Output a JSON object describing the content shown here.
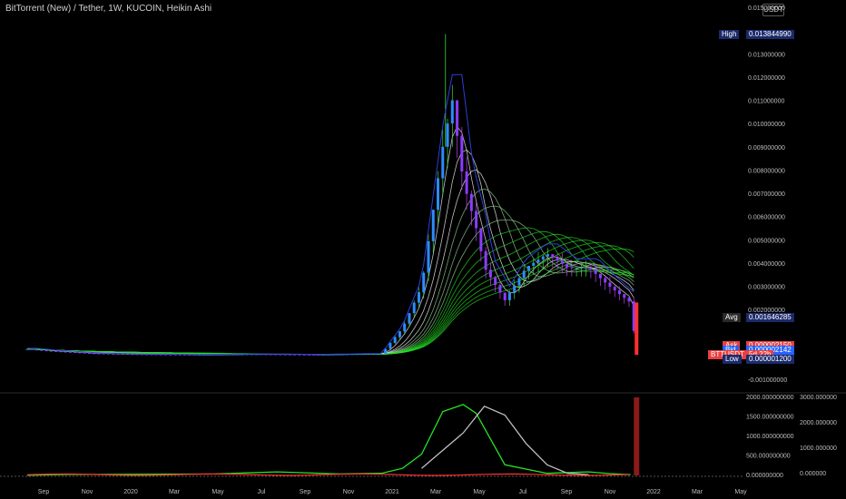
{
  "header": {
    "title": "BitTorrent (New) / Tether, 1W, KUCOIN, Heikin Ashi",
    "currency": "USDT"
  },
  "price_axis": {
    "ticks": [
      "0.015000000",
      "0.014000000",
      "0.013000000",
      "0.012000000",
      "0.011000000",
      "0.010000000",
      "0.009000000",
      "0.008000000",
      "0.007000000",
      "0.006000000",
      "0.005000000",
      "0.004000000",
      "0.003000000",
      "0.002000000",
      "0.001000000",
      "0.000000000",
      "-0.001000000"
    ],
    "tick_values": [
      0.015,
      0.014,
      0.013,
      0.012,
      0.011,
      0.01,
      0.009,
      0.008,
      0.007,
      0.006,
      0.005,
      0.004,
      0.003,
      0.002,
      0.001,
      0.0,
      -0.001
    ],
    "shown_ticks": [
      0,
      2,
      3,
      4,
      5,
      6,
      7,
      8,
      9,
      10,
      11,
      12,
      13,
      16
    ]
  },
  "tags": [
    {
      "id": "high",
      "label": "High",
      "value": "0.013844990",
      "y": 0.013845,
      "label_color": "#1b2a6b",
      "value_color": "#1b2a6b"
    },
    {
      "id": "avg",
      "label": "Avg",
      "value": "0.001646285",
      "y": 0.001646,
      "label_color": "#2a2a2a",
      "value_color": "#1b2a6b"
    },
    {
      "id": "ask",
      "label": "Ask",
      "value": "0.000002150",
      "y": 0.00045,
      "label_color": "#e84040",
      "value_color": "#e84040"
    },
    {
      "id": "bid",
      "label": "Bid",
      "value": "0.000002142",
      "y": 0.00025,
      "label_color": "#2962ff",
      "value_color": "#2962ff"
    },
    {
      "id": "last",
      "label": "BTTUSDT",
      "value": "5d 22h",
      "y": 5e-05,
      "label_color": "#e84040",
      "value_color": "#e84040"
    },
    {
      "id": "low",
      "label": "Low",
      "value": "0.000001200",
      "y": -0.00015,
      "label_color": "#1b2a6b",
      "value_color": "#1b2a6b"
    }
  ],
  "volume_axis": {
    "left_ticks": [
      "2000.000000000",
      "1500.000000000",
      "1000.000000000",
      "500.000000000",
      "0.000000000"
    ],
    "right_ticks": [
      "3000.000000",
      "2000.000000",
      "1000.000000",
      "0.000000"
    ]
  },
  "time_axis": {
    "labels": [
      "Sep",
      "Nov",
      "2020",
      "Mar",
      "May",
      "Jul",
      "Sep",
      "Nov",
      "2021",
      "Mar",
      "May",
      "Jul",
      "Sep",
      "Nov",
      "2022",
      "Mar",
      "May"
    ]
  },
  "chart_data": [
    {
      "type": "line",
      "title": "BitTorrent (New) / Tether, 1W, KUCOIN, Heikin Ashi",
      "x_range": [
        "2019-08",
        "2022-06"
      ],
      "ylim": [
        -0.001,
        0.015
      ],
      "series": [
        {
          "name": "BTTUSDT",
          "points": [
            [
              "2019-08",
              0.0003
            ],
            [
              "2019-09",
              0.00022
            ],
            [
              "2019-11",
              0.00012
            ],
            [
              "2020-01",
              8e-05
            ],
            [
              "2020-04",
              6e-05
            ],
            [
              "2020-07",
              8e-05
            ],
            [
              "2020-10",
              6e-05
            ],
            [
              "2021-01",
              0.0001
            ],
            [
              "2021-02",
              0.0012
            ],
            [
              "2021-03",
              0.003
            ],
            [
              "2021-04",
              0.009
            ],
            [
              "2021-04-15",
              0.011
            ],
            [
              "2021-05",
              0.0075
            ],
            [
              "2021-05-20",
              0.0055
            ],
            [
              "2021-06",
              0.0038
            ],
            [
              "2021-07",
              0.0024
            ],
            [
              "2021-08",
              0.0038
            ],
            [
              "2021-09",
              0.0044
            ],
            [
              "2021-10",
              0.0038
            ],
            [
              "2021-11",
              0.0038
            ],
            [
              "2021-12",
              0.003
            ],
            [
              "2022-01",
              0.0023
            ],
            [
              "2022-01-10",
              0.0001
            ]
          ]
        }
      ],
      "stats": {
        "high": 0.01384499,
        "avg": 0.001646285,
        "low": 1.2e-06
      }
    },
    {
      "type": "line",
      "ylim": [
        0,
        2200
      ],
      "series": [
        {
          "name": "green",
          "points": [
            [
              "2019-08",
              5
            ],
            [
              "2019-10",
              25
            ],
            [
              "2020-01",
              30
            ],
            [
              "2020-05",
              40
            ],
            [
              "2020-08",
              100
            ],
            [
              "2020-11",
              40
            ],
            [
              "2021-01",
              60
            ],
            [
              "2021-02",
              200
            ],
            [
              "2021-03",
              600
            ],
            [
              "2021-04",
              1800
            ],
            [
              "2021-05",
              2000
            ],
            [
              "2021-05-20",
              1750
            ],
            [
              "2021-07",
              300
            ],
            [
              "2021-09",
              60
            ],
            [
              "2021-11",
              100
            ],
            [
              "2021-12",
              50
            ],
            [
              "2022-01",
              20
            ]
          ]
        },
        {
          "name": "white",
          "points": [
            [
              "2021-03",
              200
            ],
            [
              "2021-05",
              1200
            ],
            [
              "2021-06",
              1950
            ],
            [
              "2021-07",
              1700
            ],
            [
              "2021-08",
              900
            ],
            [
              "2021-09",
              300
            ],
            [
              "2021-10",
              60
            ],
            [
              "2021-11",
              20
            ]
          ]
        }
      ]
    }
  ]
}
